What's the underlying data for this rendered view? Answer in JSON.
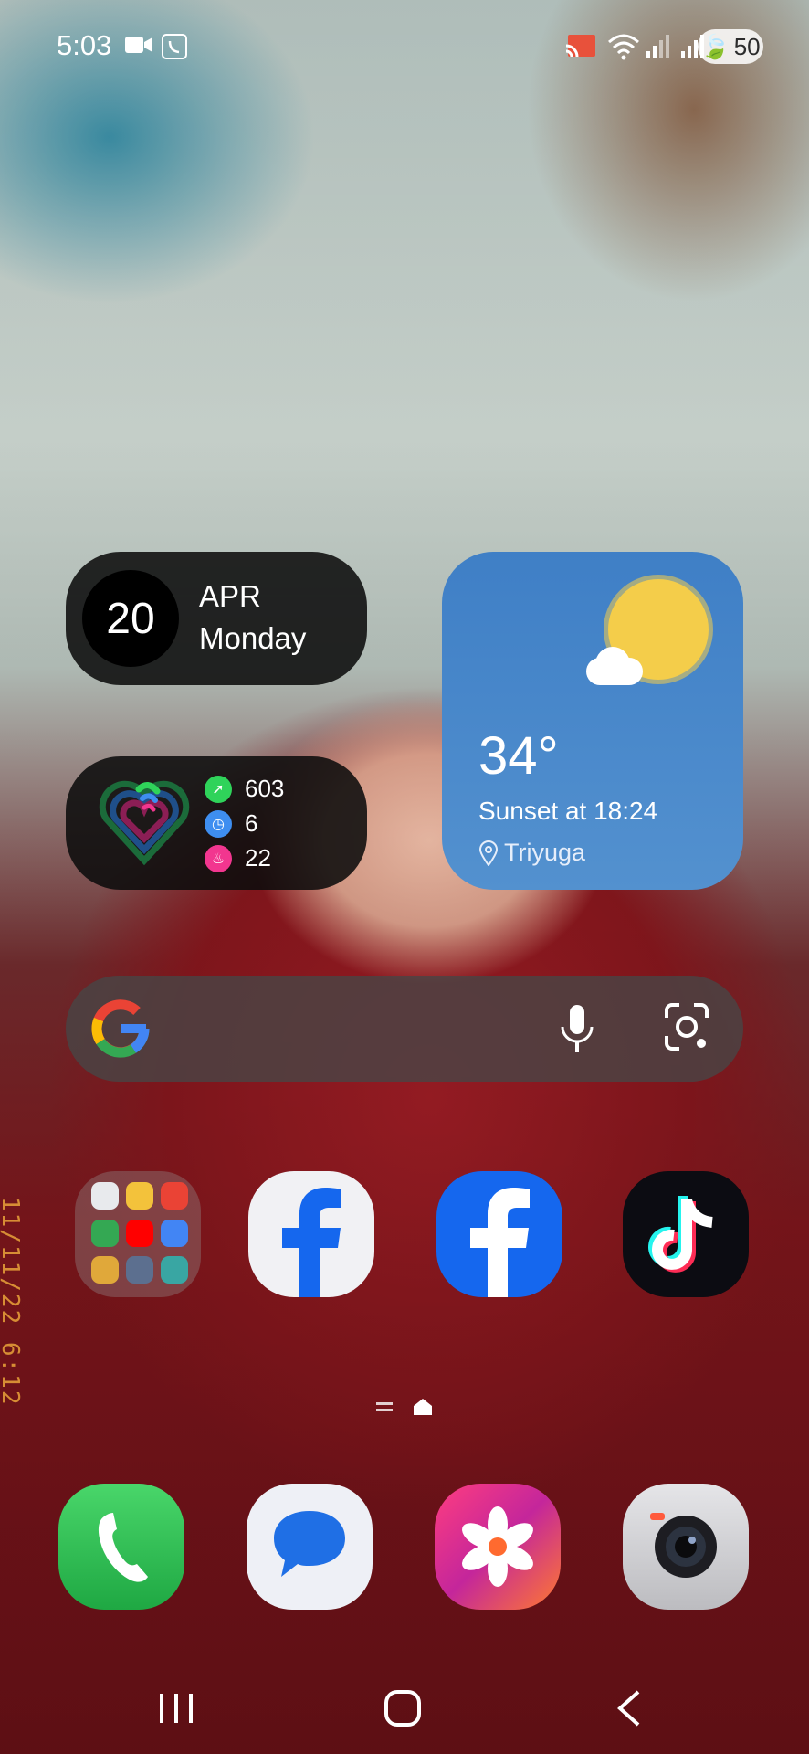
{
  "status_bar": {
    "time": "5:03",
    "battery_level": "50",
    "icons": [
      "video-camera-icon",
      "viber-icon",
      "cast-icon",
      "wifi-icon",
      "signal-1-icon",
      "signal-2-icon"
    ]
  },
  "wallpaper": {
    "stamp_text": "11/11/22 6:12"
  },
  "date_widget": {
    "day_number": "20",
    "month": "APR",
    "weekday": "Monday"
  },
  "health_widget": {
    "steps": "603",
    "active_minutes": "6",
    "calories": "22",
    "colors": {
      "steps": "#2fd35a",
      "time": "#3e8ef0",
      "calories": "#f2368f"
    }
  },
  "weather_widget": {
    "temperature": "34°",
    "sunset": "Sunset at 18:24",
    "location": "Triyuga"
  },
  "search_bar": {
    "icons": [
      "google-logo",
      "mic-icon",
      "google-lens-icon"
    ]
  },
  "apps": {
    "row1": [
      "app-folder",
      "facebook-lite",
      "facebook",
      "tiktok"
    ],
    "dock": [
      "phone",
      "messages",
      "gallery",
      "camera"
    ]
  },
  "nav_bar": {
    "buttons": [
      "recents",
      "home",
      "back"
    ]
  }
}
